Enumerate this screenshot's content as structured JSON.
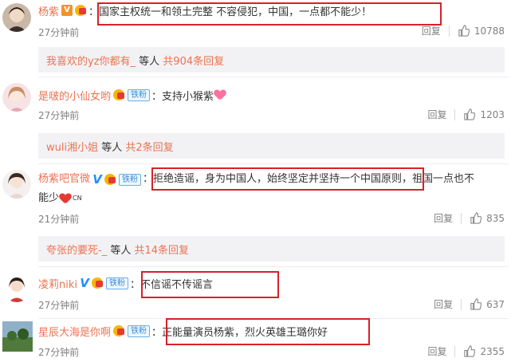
{
  "comments": [
    {
      "username": "杨紫",
      "text": "：国家主权统一和领土完整 不容侵犯，中国，一点都不能少！",
      "time": "27分钟前",
      "reply_label": "回复",
      "likes": "10788"
    },
    {
      "username": "是啵的小仙女哟",
      "fan_badge": "铁粉",
      "text": "：支持小猴紫",
      "time": "27分钟前",
      "reply_label": "回复",
      "likes": "1203"
    },
    {
      "username": "杨紫吧官微",
      "fan_badge": "铁粉",
      "text_line1": "：拒绝造谣，身为中国人，始终坚定并坚持一个中国原则，祖国一点也不",
      "text_line2": "能少",
      "flag_text": "CN",
      "time": "21分钟前",
      "reply_label": "回复",
      "likes": "835"
    },
    {
      "username": "凌莉niki",
      "fan_badge": "铁粉",
      "text": "：不信谣不传谣言",
      "time": "27分钟前",
      "reply_label": "回复",
      "likes": "637"
    },
    {
      "username": "星辰大海是你啊",
      "fan_badge": "铁粉",
      "text": "：正能量演员杨紫，烈火英雄王璐你好",
      "time": "27分钟前",
      "reply_label": "回复",
      "likes": "2355"
    }
  ],
  "reply_threads": [
    {
      "name": "我喜欢的yz你都有_",
      "mid": " 等人 ",
      "more": "共904条回复"
    },
    {
      "name": "wuli湘小姐",
      "mid": " 等人 ",
      "more": "共2条回复"
    },
    {
      "name": "夸张的要死-_",
      "mid": " 等人 ",
      "more": "共14条回复"
    }
  ],
  "icons": {
    "verified": "V",
    "like": "thumbs-up-icon"
  },
  "colors": {
    "username": "#eb7350",
    "highlight_box": "#d8202a",
    "fan_badge": "#3a8fd6"
  }
}
